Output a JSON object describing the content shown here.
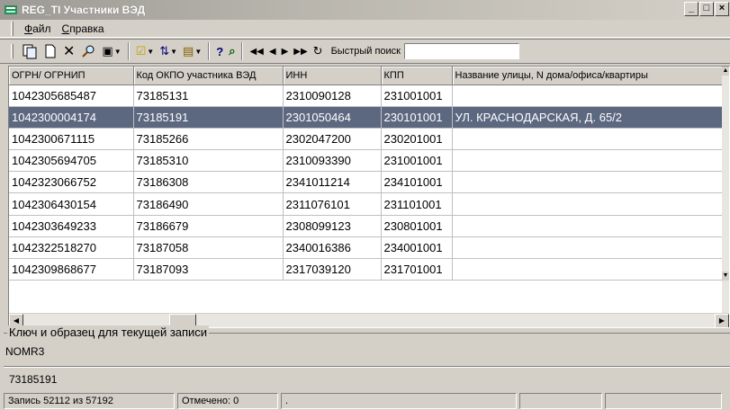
{
  "window": {
    "title": "REG_TI Участники ВЭД",
    "icon": "database-table-icon",
    "controls": [
      "_",
      "□",
      "×"
    ]
  },
  "menu": {
    "items": [
      {
        "label": "Файл"
      },
      {
        "label": "Справка"
      }
    ]
  },
  "toolbar": {
    "buttons": [
      {
        "name": "copy-record-icon",
        "glyph": "⎘"
      },
      {
        "name": "new-record-icon",
        "glyph": "🗋"
      },
      {
        "name": "delete-icon",
        "glyph": "✕"
      },
      {
        "name": "search-icon",
        "glyph": "🔍"
      },
      {
        "name": "view-icon",
        "glyph": "▣"
      },
      {
        "name": "mark-icon",
        "glyph": "☑"
      },
      {
        "name": "sort-icon",
        "glyph": "⇅"
      },
      {
        "name": "filter-icon",
        "glyph": "▤"
      },
      {
        "name": "help-icon",
        "glyph": "?"
      },
      {
        "name": "find-record-icon",
        "glyph": "⌕"
      },
      {
        "name": "first-record-icon",
        "glyph": "⏮"
      },
      {
        "name": "prev-record-icon",
        "glyph": "◂"
      },
      {
        "name": "next-record-icon",
        "glyph": "▸"
      },
      {
        "name": "last-record-icon",
        "glyph": "⏭"
      },
      {
        "name": "refresh-icon",
        "glyph": "↻"
      }
    ],
    "quick_search_label": "Быстрый поиск",
    "quick_search_value": ""
  },
  "grid": {
    "columns": [
      "ОГРН/ ОГРНИП",
      "Код ОКПО участника ВЭД",
      "ИНН",
      "КПП",
      "Название улицы, N дома/офиса/квартиры"
    ],
    "rows": [
      [
        "1042305685487",
        "73185131",
        "2310090128",
        "231001001",
        ""
      ],
      [
        "1042300004174",
        "73185191",
        "2301050464",
        "230101001",
        "УЛ. КРАСНОДАРСКАЯ, Д. 65/2"
      ],
      [
        "1042300671115",
        "73185266",
        "2302047200",
        "230201001",
        ""
      ],
      [
        "1042305694705",
        "73185310",
        "2310093390",
        "231001001",
        ""
      ],
      [
        "1042323066752",
        "73186308",
        "2341011214",
        "234101001",
        ""
      ],
      [
        "1042306430154",
        "73186490",
        "2311076101",
        "231101001",
        ""
      ],
      [
        "1042303649233",
        "73186679",
        "2308099123",
        "230801001",
        ""
      ],
      [
        "1042322518270",
        "73187058",
        "2340016386",
        "234001001",
        ""
      ],
      [
        "1042309868677",
        "73187093",
        "2317039120",
        "231701001",
        ""
      ]
    ],
    "selected_row": 1,
    "selected_color": "#5c6780"
  },
  "key_panel": {
    "legend": "Ключ и образец для текущей записи",
    "key_name": "NOMR3",
    "key_value": "73185191"
  },
  "status": {
    "record": "Запись 52112 из 57192",
    "marked": "Отмечено: 0",
    "extra": "."
  }
}
